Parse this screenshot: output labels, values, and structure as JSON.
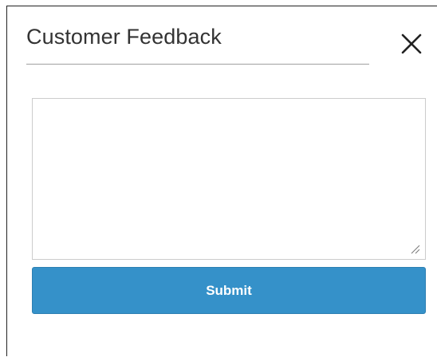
{
  "dialog": {
    "title": "Customer Feedback",
    "close_icon": "close-icon",
    "feedback": {
      "value": "",
      "placeholder": "",
      "resize_icon": "resize-grip-icon"
    },
    "submit_label": "Submit"
  },
  "colors": {
    "accent": "#3591c9",
    "title_text": "#333333",
    "divider": "#a0a0a0",
    "input_border": "#cccccc"
  }
}
